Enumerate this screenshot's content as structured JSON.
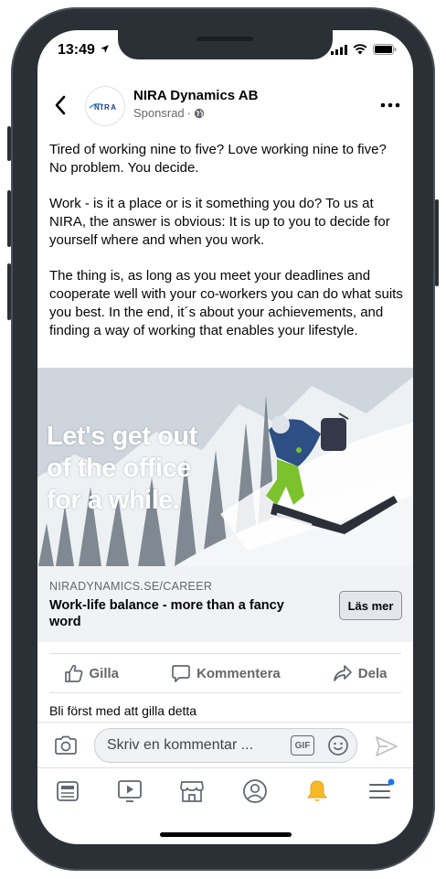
{
  "status": {
    "time": "13:49"
  },
  "post": {
    "page_name": "NIRA Dynamics AB",
    "sponsored": "Sponsrad",
    "avatar_logo": "NIRA",
    "paragraphs": [
      "Tired of working nine to five? Love working nine to five? No problem. You decide.",
      "Work - is it a place or is it something you do? To us at NIRA, the answer is obvious: It is up to you to decide for yourself where and when you work.",
      "The thing is, as long as you meet your deadlines and cooperate well with your co-workers you can do what suits you best. In the end, it´s about your achievements, and finding a way of working that enables your lifestyle."
    ],
    "image_headline": [
      "Let's get out",
      "of the office",
      "for a while."
    ],
    "link": {
      "domain": "NIRADYNAMICS.SE/CAREER",
      "title": "Work-life balance - more than a fancy word",
      "cta": "Läs mer"
    },
    "actions": {
      "like": "Gilla",
      "comment": "Kommentera",
      "share": "Dela"
    },
    "first_like": "Bli först med att gilla detta",
    "comment_placeholder": "Skriv en kommentar ...",
    "gif_label": "GIF"
  },
  "colors": {
    "notification_dot": "#1877f2",
    "bell_active": "#f7b928",
    "frame": "#2b3037"
  },
  "tabs": [
    "news-feed-icon",
    "watch-icon",
    "marketplace-icon",
    "profile-icon",
    "notifications-icon",
    "menu-icon"
  ]
}
